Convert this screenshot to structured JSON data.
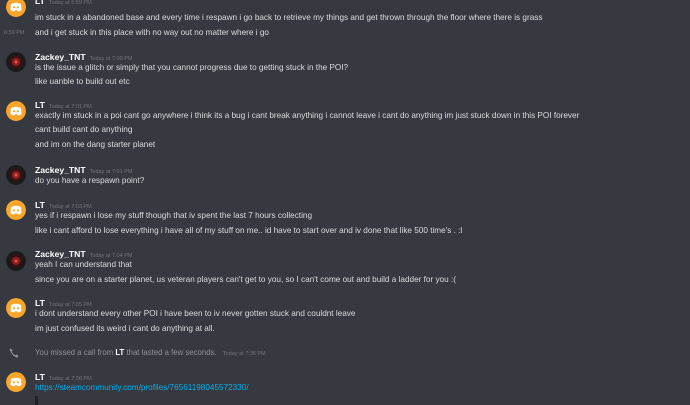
{
  "colors": {
    "background": "#36393f",
    "discord_blurple": "#7289da",
    "lt_avatar": "#f9a62b",
    "link": "#00b0f4",
    "timestamp": "#72767d"
  },
  "messages": {
    "m0": {
      "author": "LT",
      "time": "Today at 6:59 PM",
      "lines": [
        "im stuck in a abandoned base and every time i respawn i go back to retrieve my things and get thrown through the floor where there is grass",
        "and i get stuck in this place with no way out no matter where i go"
      ],
      "gutter_time": "6:59 PM"
    },
    "m1": {
      "author": "Zackey_TNT",
      "time": "Today at 7:00 PM",
      "lines": [
        "is the issue a glitch or simply that you cannot progress due to getting stuck in the POI?",
        "like uanble to build out etc"
      ]
    },
    "m2": {
      "author": "LT",
      "time": "Today at 7:01 PM",
      "lines": [
        "exactly im stuck in a poi cant go anywhere i think its a bug i cant break anything i cannot leave i cant do anything im just stuck down in this POI forever",
        "cant build cant do anything",
        "and im on the dang starter planet"
      ]
    },
    "m3": {
      "author": "Zackey_TNT",
      "time": "Today at 7:01 PM",
      "lines": [
        "do you have a respawn point?"
      ]
    },
    "m4": {
      "author": "LT",
      "time": "Today at 7:03 PM",
      "lines": [
        "yes if i respawn i lose my stuff though that iv spent the last 7 hours collecting",
        "like i cant afford to lose everything i have all of my stuff on me.. id have to start over and iv done that like 500 time's . :l"
      ]
    },
    "m5": {
      "author": "Zackey_TNT",
      "time": "Today at 7:04 PM",
      "lines": [
        "yeah I can understand that",
        "since you are on a starter planet, us veteran players can't get to you, so I can't come out and build a ladder for you :("
      ]
    },
    "m6": {
      "author": "LT",
      "time": "Today at 7:05 PM",
      "lines": [
        "i dont understand every other POI i have been to iv never gotten stuck and couldnt leave",
        "im just confused its weird i cant do anything at all."
      ]
    },
    "call": {
      "prefix": "You missed a call from",
      "caller": "LT",
      "suffix": "that lasted a few seconds.",
      "time": "Today at 7:36 PM"
    },
    "m7": {
      "author": "LT",
      "time": "Today at 7:36 PM",
      "link": "https://steamcommunity.com/profiles/76561198045572330/"
    }
  }
}
